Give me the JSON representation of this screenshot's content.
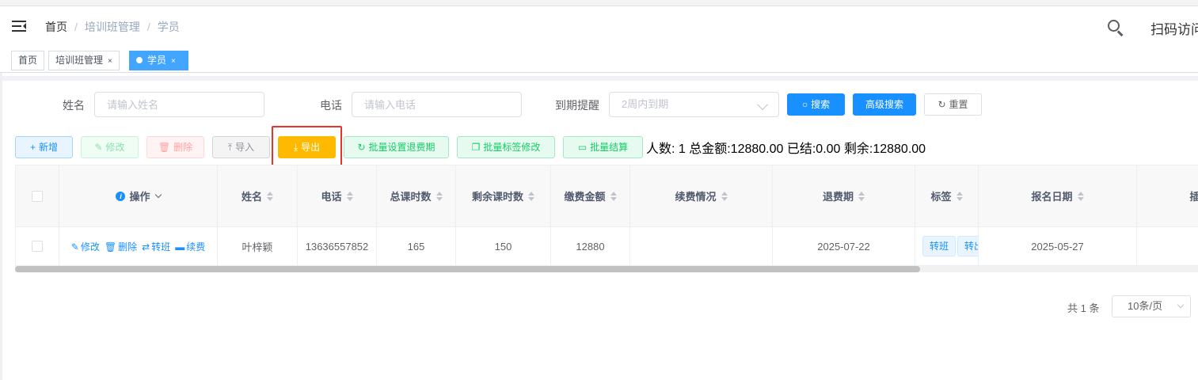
{
  "navbar": {
    "breadcrumb": [
      "首页",
      "培训班管理",
      "学员"
    ],
    "separator": "/",
    "scan_text": "扫码访问"
  },
  "tags_view": {
    "tags": [
      {
        "label": "首页",
        "closable": false,
        "active": false
      },
      {
        "label": "培训班管理",
        "closable": true,
        "active": false
      },
      {
        "label": "学员",
        "closable": true,
        "active": true
      }
    ],
    "close_glyph": "×"
  },
  "filters": {
    "name_label": "姓名",
    "name_placeholder": "请输入姓名",
    "phone_label": "电话",
    "phone_placeholder": "请输入电话",
    "expire_label": "到期提醒",
    "expire_value": "2周内到期",
    "search_button": "搜索",
    "advanced_search_button": "高级搜索",
    "reset_button": "重置"
  },
  "toolbar": {
    "add": "新增",
    "edit": "修改",
    "delete": "删除",
    "import": "导入",
    "export": "导出",
    "batch_refund_period": "批量设置退费期",
    "batch_tag_edit": "批量标签修改",
    "batch_settle": "批量结算",
    "summary": "人数: 1 总金额:12880.00 已结:0.00 剩余:12880.00"
  },
  "table": {
    "columns": [
      "",
      "操作",
      "姓名",
      "电话",
      "总课时数",
      "剩余课时数",
      "缴费金额",
      "续费情况",
      "退费期",
      "标签",
      "报名日期",
      "插班"
    ],
    "rows": [
      {
        "actions": [
          "修改",
          "删除",
          "转班",
          "续费"
        ],
        "name": "叶梓颖",
        "phone": "13636557852",
        "total_hours": "165",
        "remaining_hours": "150",
        "payment": "12880",
        "renewal": "",
        "refund_period": "2025-07-22",
        "tags": [
          "转班",
          "转出"
        ],
        "signup_date": "2025-05-27",
        "insert_class": ""
      }
    ]
  },
  "pagination": {
    "total": "共 1 条",
    "page_size": "10条/页"
  },
  "colors": {
    "primary": "#1890ff",
    "warning": "#ffba00",
    "success": "#13ce66",
    "danger": "#ff4949",
    "highlight_border": "#e8332a",
    "active_tag": "#42a5ff"
  }
}
